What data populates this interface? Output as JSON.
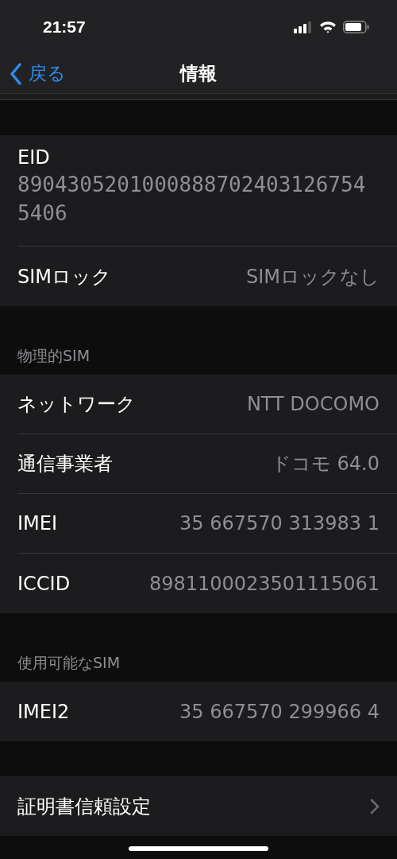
{
  "status_bar": {
    "time": "21:57"
  },
  "nav": {
    "back": "戻る",
    "title": "情報"
  },
  "sections": [
    {
      "rows": [
        {
          "kind": "stacked",
          "label": "EID",
          "value": "89043052010008887024031267545406"
        },
        {
          "kind": "value",
          "label": "SIMロック",
          "value": "SIMロックなし"
        }
      ]
    },
    {
      "header": "物理的SIM",
      "rows": [
        {
          "kind": "value",
          "label": "ネットワーク",
          "value": "NTT DOCOMO"
        },
        {
          "kind": "value",
          "label": "通信事業者",
          "value": "ドコモ 64.0"
        },
        {
          "kind": "value",
          "label": "IMEI",
          "value": "35 667570 313983 1"
        },
        {
          "kind": "value",
          "label": "ICCID",
          "value": "8981100023501115061"
        }
      ]
    },
    {
      "header": "使用可能なSIM",
      "rows": [
        {
          "kind": "value",
          "label": "IMEI2",
          "value": "35 667570 299966 4"
        }
      ]
    },
    {
      "rows": [
        {
          "kind": "link",
          "label": "証明書信頼設定"
        }
      ]
    }
  ]
}
